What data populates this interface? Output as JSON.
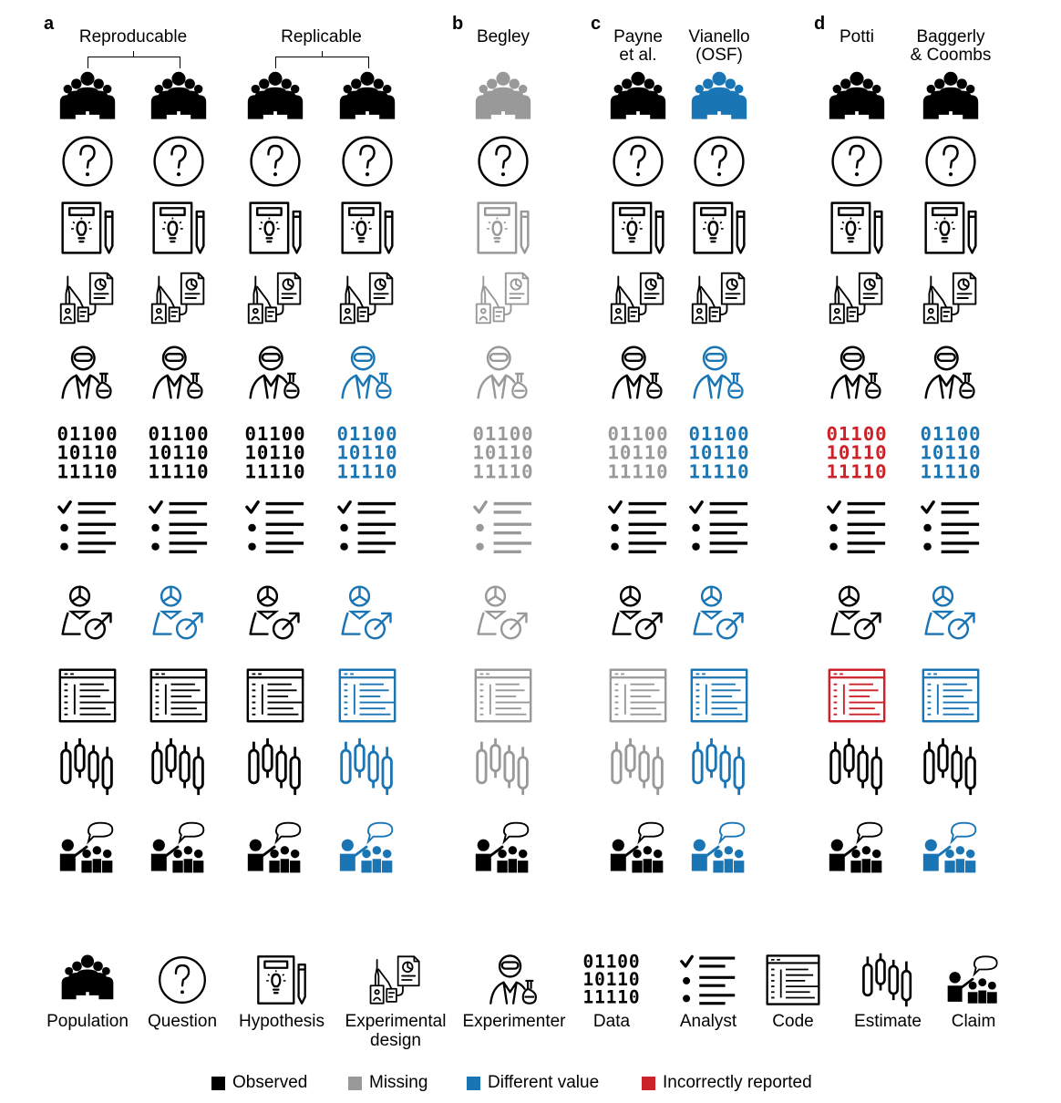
{
  "colors": {
    "observed": "#000000",
    "missing": "#999999",
    "different": "#1a75b5",
    "incorrect": "#cc2229"
  },
  "panels": [
    {
      "letter": "a",
      "groups": [
        {
          "label": "Reproducable",
          "cols": [
            0,
            1
          ]
        },
        {
          "label": "Replicable",
          "cols": [
            2,
            3
          ]
        }
      ]
    },
    {
      "letter": "b",
      "groups": []
    },
    {
      "letter": "c",
      "groups": []
    },
    {
      "letter": "d",
      "groups": []
    }
  ],
  "columns": [
    {
      "label": "",
      "states": [
        "observed",
        "observed",
        "observed",
        "observed",
        "observed",
        "observed",
        "observed",
        "observed",
        "observed",
        "observed",
        "observed"
      ]
    },
    {
      "label": "",
      "states": [
        "observed",
        "observed",
        "observed",
        "observed",
        "observed",
        "observed",
        "observed",
        "different",
        "observed",
        "observed",
        "observed"
      ]
    },
    {
      "label": "",
      "states": [
        "observed",
        "observed",
        "observed",
        "observed",
        "observed",
        "observed",
        "observed",
        "observed",
        "observed",
        "observed",
        "observed"
      ]
    },
    {
      "label": "",
      "states": [
        "observed",
        "observed",
        "observed",
        "observed",
        "different",
        "different",
        "observed",
        "different",
        "different",
        "different",
        "different"
      ]
    },
    {
      "label": "Begley",
      "states": [
        "missing",
        "observed",
        "missing",
        "missing",
        "missing",
        "missing",
        "missing",
        "missing",
        "missing",
        "missing",
        "observed"
      ]
    },
    {
      "label": "Payne\net al.",
      "states": [
        "observed",
        "observed",
        "observed",
        "observed",
        "observed",
        "missing",
        "observed",
        "observed",
        "missing",
        "missing",
        "observed"
      ]
    },
    {
      "label": "Vianello\n(OSF)",
      "states": [
        "different",
        "observed",
        "observed",
        "observed",
        "different",
        "different",
        "observed",
        "different",
        "different",
        "different",
        "different"
      ]
    },
    {
      "label": "Potti",
      "states": [
        "observed",
        "observed",
        "observed",
        "observed",
        "observed",
        "incorrect",
        "observed",
        "observed",
        "incorrect",
        "observed",
        "observed"
      ]
    },
    {
      "label": "Baggerly\n& Coombs",
      "states": [
        "observed",
        "observed",
        "observed",
        "observed",
        "observed",
        "different",
        "observed",
        "different",
        "different",
        "observed",
        "different"
      ]
    }
  ],
  "rows": [
    {
      "icon": "population-icon"
    },
    {
      "icon": "question-icon"
    },
    {
      "icon": "hypothesis-icon"
    },
    {
      "icon": "experimental-design-icon"
    },
    {
      "icon": "experimenter-icon"
    },
    {
      "icon": "data-icon",
      "bits": [
        "01100",
        "10110",
        "11110"
      ]
    },
    {
      "icon": "analyst-icon"
    },
    {
      "icon": "estimate-person-icon"
    },
    {
      "icon": "code-icon"
    },
    {
      "icon": "estimate-icon"
    },
    {
      "icon": "claim-icon"
    }
  ],
  "icon_legend": [
    {
      "icon": "population-icon",
      "label": "Population"
    },
    {
      "icon": "question-icon",
      "label": "Question"
    },
    {
      "icon": "hypothesis-icon",
      "label": "Hypothesis"
    },
    {
      "icon": "experimental-design-icon",
      "label": "Experimental\ndesign"
    },
    {
      "icon": "experimenter-icon",
      "label": "Experimenter"
    },
    {
      "icon": "data-icon",
      "label": "Data"
    },
    {
      "icon": "analyst-icon",
      "label": "Analyst"
    },
    {
      "icon": "code-icon",
      "label": "Code"
    },
    {
      "icon": "estimate-icon",
      "label": "Estimate"
    },
    {
      "icon": "claim-icon",
      "label": "Claim"
    }
  ],
  "color_key": [
    {
      "state": "observed",
      "label": "Observed"
    },
    {
      "state": "missing",
      "label": "Missing"
    },
    {
      "state": "different",
      "label": "Different value"
    },
    {
      "state": "incorrect",
      "label": "Incorrectly reported"
    }
  ]
}
